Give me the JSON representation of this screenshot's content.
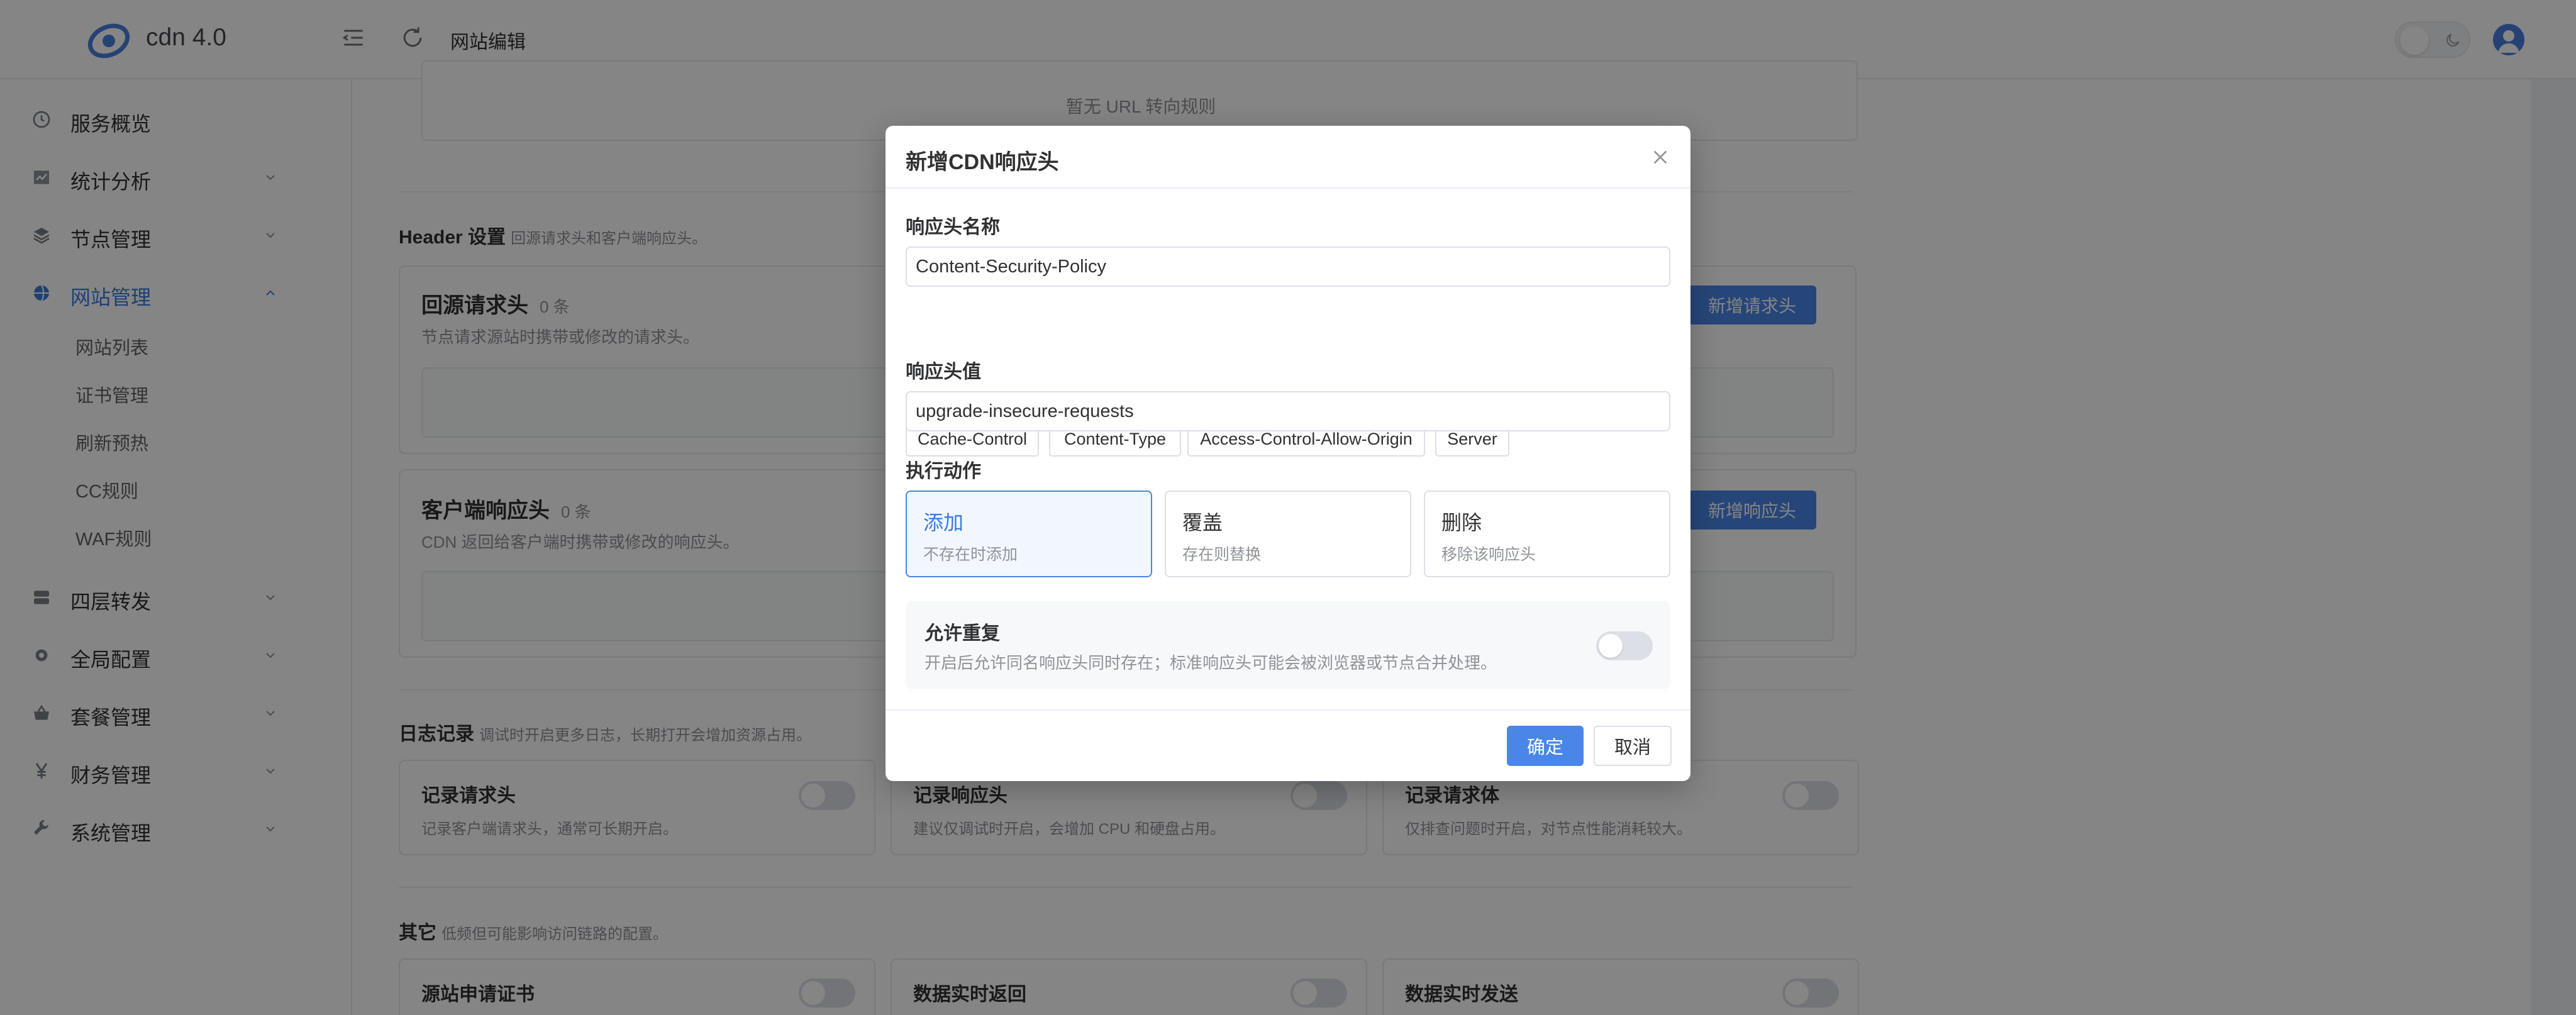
{
  "header": {
    "app_name": "cdn 4.0",
    "page_title": "网站编辑",
    "icons": [
      "menu-fold-icon",
      "refresh-icon",
      "sun-icon",
      "moon-icon",
      "user-avatar-icon"
    ]
  },
  "sidebar": {
    "items": [
      {
        "label": "服务概览",
        "icon": "dashboard-icon"
      },
      {
        "label": "统计分析",
        "icon": "chart-icon"
      },
      {
        "label": "节点管理",
        "icon": "layers-icon"
      },
      {
        "label": "网站管理",
        "icon": "globe-icon",
        "active": true
      },
      {
        "label": "四层转发",
        "icon": "server-icon"
      },
      {
        "label": "全局配置",
        "icon": "gear-icon"
      },
      {
        "label": "套餐管理",
        "icon": "basket-icon"
      },
      {
        "label": "财务管理",
        "icon": "yen-icon"
      },
      {
        "label": "系统管理",
        "icon": "wrench-icon"
      }
    ],
    "sub_items": [
      "网站列表",
      "证书管理",
      "刷新预热",
      "CC规则",
      "WAF规则"
    ]
  },
  "main": {
    "url_redirect_empty": "暂无 URL 转向规则",
    "header_section": {
      "title": "Header 设置",
      "desc": "回源请求头和客户端响应头。"
    },
    "origin_request_header": {
      "title": "回源请求头",
      "count": "0 条",
      "desc": "节点请求源站时携带或修改的请求头。",
      "button": "新增请求头"
    },
    "client_response_header": {
      "title": "客户端响应头",
      "count": "0 条",
      "desc": "CDN 返回给客户端时携带或修改的响应头。",
      "button": "新增响应头"
    },
    "log_section": {
      "title": "日志记录",
      "desc": "调试时开启更多日志，长期打开会增加资源占用。"
    },
    "log_cards": [
      {
        "title": "记录请求头",
        "desc": "记录客户端请求头，通常可长期开启。"
      },
      {
        "title": "记录响应头",
        "desc": "建议仅调试时开启，会增加 CPU 和硬盘占用。"
      },
      {
        "title": "记录请求体",
        "desc": "仅排查问题时开启，对节点性能消耗较大。"
      }
    ],
    "other_section": {
      "title": "其它",
      "desc": "低频但可能影响访问链路的配置。"
    },
    "other_cards": [
      {
        "title": "源站申请证书"
      },
      {
        "title": "数据实时返回"
      },
      {
        "title": "数据实时发送"
      }
    ]
  },
  "modal": {
    "title": "新增CDN响应头",
    "name_label": "响应头名称",
    "name_value": "Content-Security-Policy",
    "chips": [
      "Cache-Control",
      "Content-Type",
      "Access-Control-Allow-Origin",
      "Server"
    ],
    "value_label": "响应头值",
    "value_value": "upgrade-insecure-requests",
    "action_label": "执行动作",
    "actions": [
      {
        "title": "添加",
        "desc": "不存在时添加",
        "selected": true
      },
      {
        "title": "覆盖",
        "desc": "存在则替换",
        "selected": false
      },
      {
        "title": "删除",
        "desc": "移除该响应头",
        "selected": false
      }
    ],
    "allow_dup": {
      "title": "允许重复",
      "desc": "开启后允许同名响应头同时存在；标准响应头可能会被浏览器或节点合并处理。",
      "enabled": false
    },
    "ok_label": "确定",
    "cancel_label": "取消"
  },
  "colors": {
    "primary": "#4a86e8",
    "active_nav": "#3b7be0",
    "mask": "rgba(0,0,0,0.48)"
  }
}
